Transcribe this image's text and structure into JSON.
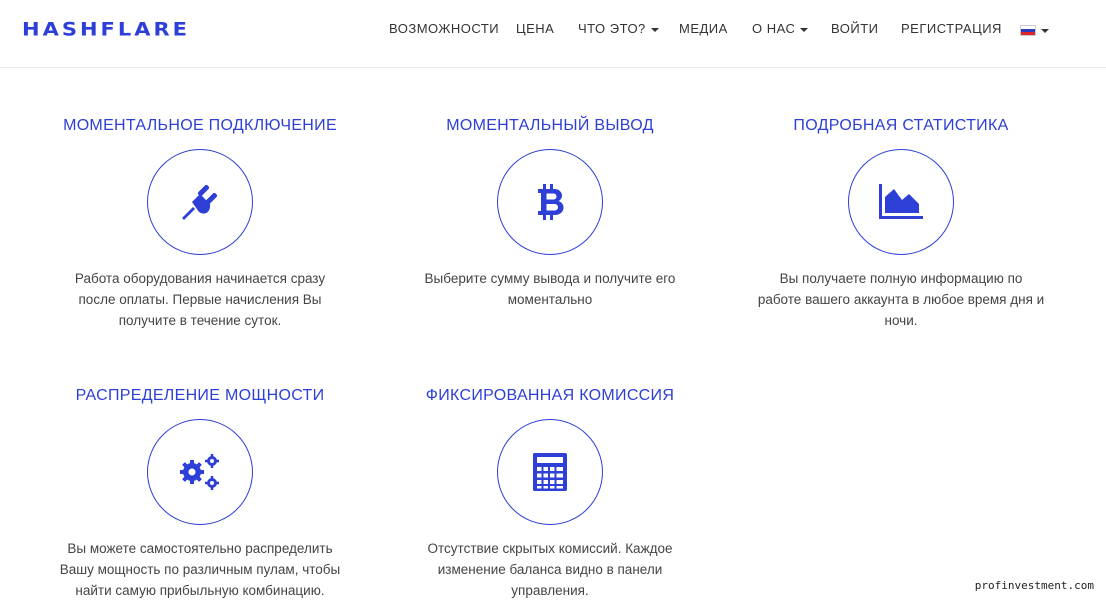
{
  "brand": {
    "logo": "HASHFLARE",
    "accent": "#2d3fd6"
  },
  "nav": {
    "items": [
      {
        "label": "ВОЗМОЖНОСТИ",
        "dropdown": false
      },
      {
        "label": "ЦЕНА",
        "dropdown": false
      },
      {
        "label": "ЧТО ЭТО?",
        "dropdown": true
      },
      {
        "label": "МЕДИА",
        "dropdown": false
      },
      {
        "label": "О НАС",
        "dropdown": true
      },
      {
        "label": "ВОЙТИ",
        "dropdown": false
      },
      {
        "label": "РЕГИСТРАЦИЯ",
        "dropdown": false
      }
    ],
    "language": {
      "icon": "russia-flag-icon",
      "dropdown": true
    }
  },
  "features": [
    {
      "title": "МОМЕНТАЛЬНОЕ ПОДКЛЮЧЕНИЕ",
      "icon": "plug-icon",
      "text": "Работа оборудования начинается сразу после оплаты. Первые начисления Вы получите в течение суток."
    },
    {
      "title": "МОМЕНТАЛЬНЫЙ ВЫВОД",
      "icon": "bitcoin-icon",
      "text": "Выберите сумму вывода и получите его моментально"
    },
    {
      "title": "ПОДРОБНАЯ СТАТИСТИКА",
      "icon": "area-chart-icon",
      "text": "Вы получаете полную информацию по работе вашего аккаунта в любое время дня и ночи."
    },
    {
      "title": "РАСПРЕДЕЛЕНИЕ МОЩНОСТИ",
      "icon": "gears-icon",
      "text": "Вы можете самостоятельно распределить Вашу мощность по различным пулам, чтобы найти самую прибыльную комбинацию."
    },
    {
      "title": "ФИКСИРОВАННАЯ КОМИССИЯ",
      "icon": "calculator-icon",
      "text": "Отсутствие скрытых комиссий. Каждое изменение баланса видно в панели управления."
    }
  ],
  "watermark": "profinvestment.com"
}
